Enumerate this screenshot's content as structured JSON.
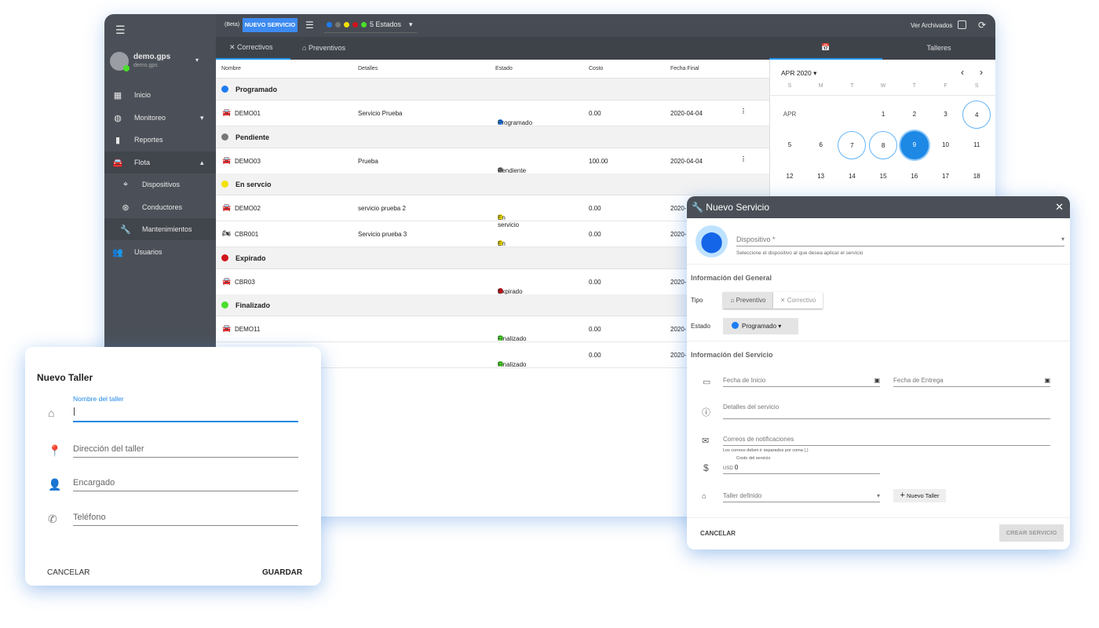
{
  "colors": {
    "accent": "#2196f3",
    "programado": "#1e7cf2",
    "pendiente": "#777777",
    "en_servicio": "#f5e000",
    "expirado": "#d0141c",
    "finalizado": "#4cde2c"
  },
  "topbar": {
    "beta": "(Beta)",
    "new_service": "NUEVO SERVICIO",
    "states": "5 Estados",
    "archived": "Ver Archivados"
  },
  "user": {
    "name": "demo.gps",
    "sub": "demo.gps"
  },
  "sidebar": {
    "items": [
      {
        "label": "Inicio",
        "icon": "dashboard-icon"
      },
      {
        "label": "Monitoreo",
        "icon": "globe-icon"
      },
      {
        "label": "Reportes",
        "icon": "bar-chart-icon"
      },
      {
        "label": "Flota",
        "icon": "car-icon"
      },
      {
        "label": "Dispositivos",
        "icon": "gps-icon"
      },
      {
        "label": "Conductores",
        "icon": "steering-wheel-icon"
      },
      {
        "label": "Mantenimientos",
        "icon": "wrench-icon"
      },
      {
        "label": "Usuarios",
        "icon": "people-icon"
      }
    ]
  },
  "tabs": {
    "correctivos": "Correctivos",
    "preventivos": "Preventivos",
    "talleres": "Talleres"
  },
  "table": {
    "headers": [
      "Nombre",
      "Detalles",
      "Estado",
      "Costo",
      "Fecha Final"
    ],
    "groups": [
      "Programado",
      "Pendiente",
      "En servcio",
      "Expirado",
      "Finalizado"
    ],
    "rows": [
      {
        "name": "DEMO01",
        "details": "Servicio Prueba",
        "state": "Programado",
        "cost": "0.00",
        "date": "2020-04-04"
      },
      {
        "name": "DEMO03",
        "details": "Prueba",
        "state": "Pendiente",
        "cost": "100.00",
        "date": "2020-04-04"
      },
      {
        "name": "DEMO02",
        "details": "servicio prueba 2",
        "state": "En servicio",
        "cost": "0.00",
        "date": "2020-"
      },
      {
        "name": "CBR001",
        "details": "Servicio prueba 3",
        "state": "En servicio",
        "cost": "0.00",
        "date": "2020-"
      },
      {
        "name": "CBR03",
        "details": "",
        "state": "Expirado",
        "cost": "0.00",
        "date": "2020-"
      },
      {
        "name": "DEMO11",
        "details": "",
        "state": "Finalizado",
        "cost": "0.00",
        "date": "2020-"
      },
      {
        "name": "",
        "details": "",
        "state": "Finalizado",
        "cost": "0.00",
        "date": "2020-"
      }
    ]
  },
  "calendar": {
    "month": "APR 2020",
    "weekdays": [
      "S",
      "M",
      "T",
      "W",
      "T",
      "F",
      "S"
    ],
    "label": "APR",
    "days": [
      "1",
      "2",
      "3",
      "4",
      "5",
      "6",
      "7",
      "8",
      "9",
      "10",
      "11",
      "12",
      "13",
      "14",
      "15",
      "16",
      "17",
      "18"
    ],
    "selected": "9",
    "marked": [
      "4",
      "7",
      "8"
    ]
  },
  "nuevo_servicio": {
    "title": "Nuevo Servicio",
    "device": "Dispositivo *",
    "device_hint": "Seleccione el dispositivo al que desea aplicar el servicio",
    "general": "Información del General",
    "tipo": "Tipo",
    "preventivo": "Preventivo",
    "correctivo": "Correctivo",
    "estado": "Estado",
    "estado_val": "Programado",
    "servicio": "Información del Servicio",
    "fecha_inicio": "Fecha de Inicio",
    "fecha_entrega": "Fecha de Entrega",
    "detalles": "Detalles del servicio",
    "correos": "Correos de notificaciones",
    "correos_hint": "Los correos deben ir separados por coma (,)",
    "costo_label": "Costo del servicio",
    "currency": "USD",
    "costo": "0",
    "taller": "Taller definido",
    "nuevo_taller": "Nuevo Taller",
    "cancel": "CANCELAR",
    "create": "CREAR SERVICIO"
  },
  "nuevo_taller": {
    "title": "Nuevo Taller",
    "nombre": "Nombre del taller",
    "direccion": "Dirección del taller",
    "encargado": "Encargado",
    "telefono": "Teléfono",
    "cancel": "CANCELAR",
    "save": "GUARDAR"
  }
}
